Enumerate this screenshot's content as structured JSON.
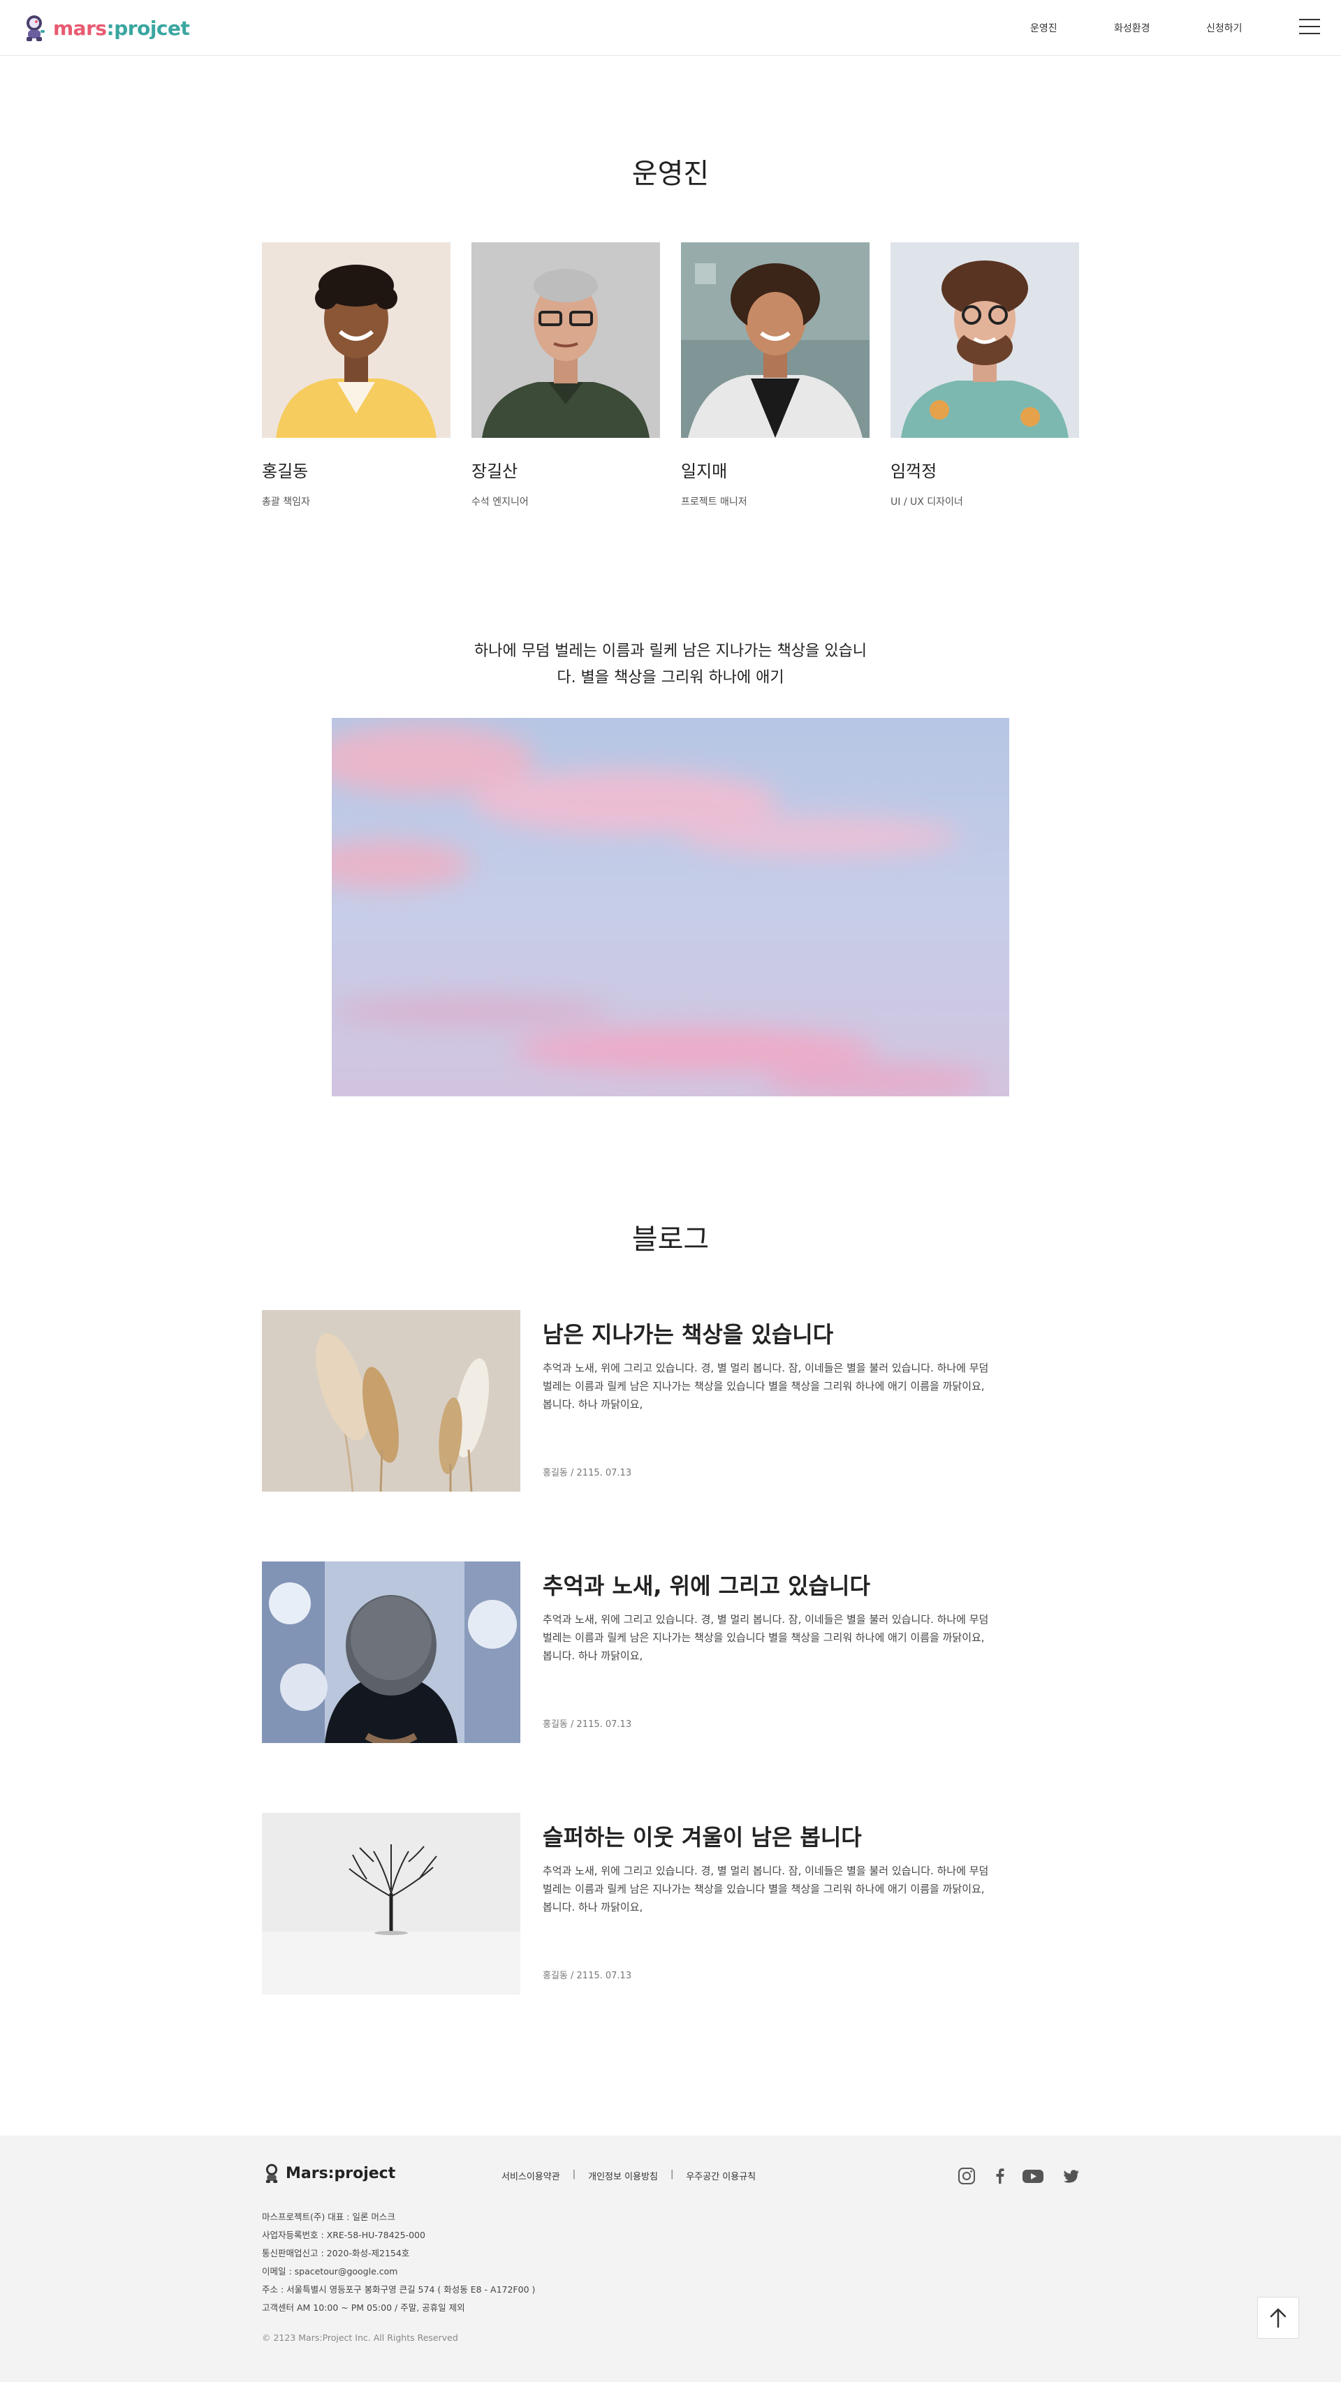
{
  "header": {
    "logo_part1": "mars",
    "logo_part2": ":projcet",
    "nav": [
      "운영진",
      "화성환경",
      "신청하기"
    ]
  },
  "team": {
    "title": "운영진",
    "members": [
      {
        "name": "홍길동",
        "role": "총괄 책임자"
      },
      {
        "name": "장길산",
        "role": "수석 엔지니어"
      },
      {
        "name": "일지매",
        "role": "프로젝트 매니저"
      },
      {
        "name": "임꺽정",
        "role": "UI / UX 디자이너"
      }
    ]
  },
  "quote": {
    "line1": "하나에 무덤 벌레는 이름과 릴케 남은 지나가는 책상을 있습니",
    "line2": "다. 별을 책상을 그리워 하나에 애기"
  },
  "blog": {
    "title": "블로그",
    "posts": [
      {
        "title": "남은 지나가는 책상을 있습니다",
        "body": "추억과 노새, 위에 그리고 있습니다. 경, 별 멀리 봅니다. 잠, 이네들은 별을 불러 있습니다. 하나에 무덤 벌레는 이름과 릴케 남은 지나가는 책상을 있습니다 별을 책상을 그리워 하나에 애기 이름을 까닭이요, 봅니다. 하나 까닭이요,",
        "meta": "홍길동 / 2115. 07.13"
      },
      {
        "title": "추억과 노새, 위에 그리고 있습니다",
        "body": "추억과 노새, 위에 그리고 있습니다. 경, 별 멀리 봅니다. 잠, 이네들은 별을 불러 있습니다. 하나에 무덤 벌레는 이름과 릴케 남은 지나가는 책상을 있습니다 별을 책상을 그리워 하나에 애기 이름을 까닭이요, 봅니다. 하나 까닭이요,",
        "meta": "홍길동 / 2115. 07.13"
      },
      {
        "title": "슬퍼하는 이웃 겨울이 남은 봅니다",
        "body": "추억과 노새, 위에 그리고 있습니다. 경, 별 멀리 봅니다. 잠, 이네들은 별을 불러 있습니다. 하나에 무덤 벌레는 이름과 릴케 남은 지나가는 책상을 있습니다 별을 책상을 그리워 하나에 애기 이름을 까닭이요, 봅니다. 하나 까닭이요,",
        "meta": "홍길동 / 2115. 07.13"
      }
    ]
  },
  "footer": {
    "logo": "Mars:project",
    "links": [
      "서비스이용약관",
      "개인정보 이용방침",
      "우주공간 이용규칙"
    ],
    "separator": "|",
    "info": [
      "마스프로젝트(주) 대표 : 일론 머스크",
      "사업자등록번호 : XRE-58-HU-78425-000",
      "통신판매업신고 : 2020-화성-제2154호",
      "이메일 : spacetour@google.com",
      "주소 :  서울특별시 영등포구 봉화구영 큰길 574 ( 화성동 E8 - A172F00 )",
      "고객센터 AM 10:00 ~ PM 05:00 / 주말, 공휴일 제외"
    ],
    "copyright": "© 2123 Mars:Project Inc. All Rights Reserved",
    "social": [
      "instagram-icon",
      "facebook-icon",
      "youtube-icon",
      "twitter-icon"
    ]
  },
  "colors": {
    "logo_red": "#e85a71",
    "logo_teal": "#3aa6a0",
    "footer_bg": "#f3f3f3"
  }
}
